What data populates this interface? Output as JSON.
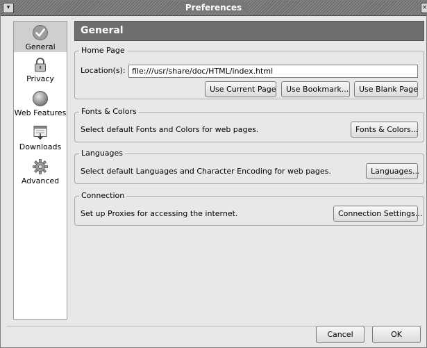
{
  "window": {
    "title": "Preferences"
  },
  "sidebar": {
    "items": [
      {
        "label": "General",
        "icon": "checkmark-icon",
        "selected": true
      },
      {
        "label": "Privacy",
        "icon": "lock-icon",
        "selected": false
      },
      {
        "label": "Web Features",
        "icon": "globe-icon",
        "selected": false
      },
      {
        "label": "Downloads",
        "icon": "download-icon",
        "selected": false
      },
      {
        "label": "Advanced",
        "icon": "gear-icon",
        "selected": false
      }
    ]
  },
  "main": {
    "header": "General",
    "home_page": {
      "legend": "Home Page",
      "location_label": "Location(s):",
      "location_value": "file:///usr/share/doc/HTML/index.html",
      "use_current_label": "Use Current Page",
      "use_bookmark_label": "Use Bookmark...",
      "use_blank_label": "Use Blank Page"
    },
    "fonts_colors": {
      "legend": "Fonts & Colors",
      "description": "Select default Fonts and Colors for web pages.",
      "button_label": "Fonts & Colors..."
    },
    "languages": {
      "legend": "Languages",
      "description": "Select default Languages and Character Encoding for web pages.",
      "button_label": "Languages..."
    },
    "connection": {
      "legend": "Connection",
      "description": "Set up Proxies for accessing the internet.",
      "button_label": "Connection Settings..."
    }
  },
  "footer": {
    "cancel_label": "Cancel",
    "ok_label": "OK"
  }
}
